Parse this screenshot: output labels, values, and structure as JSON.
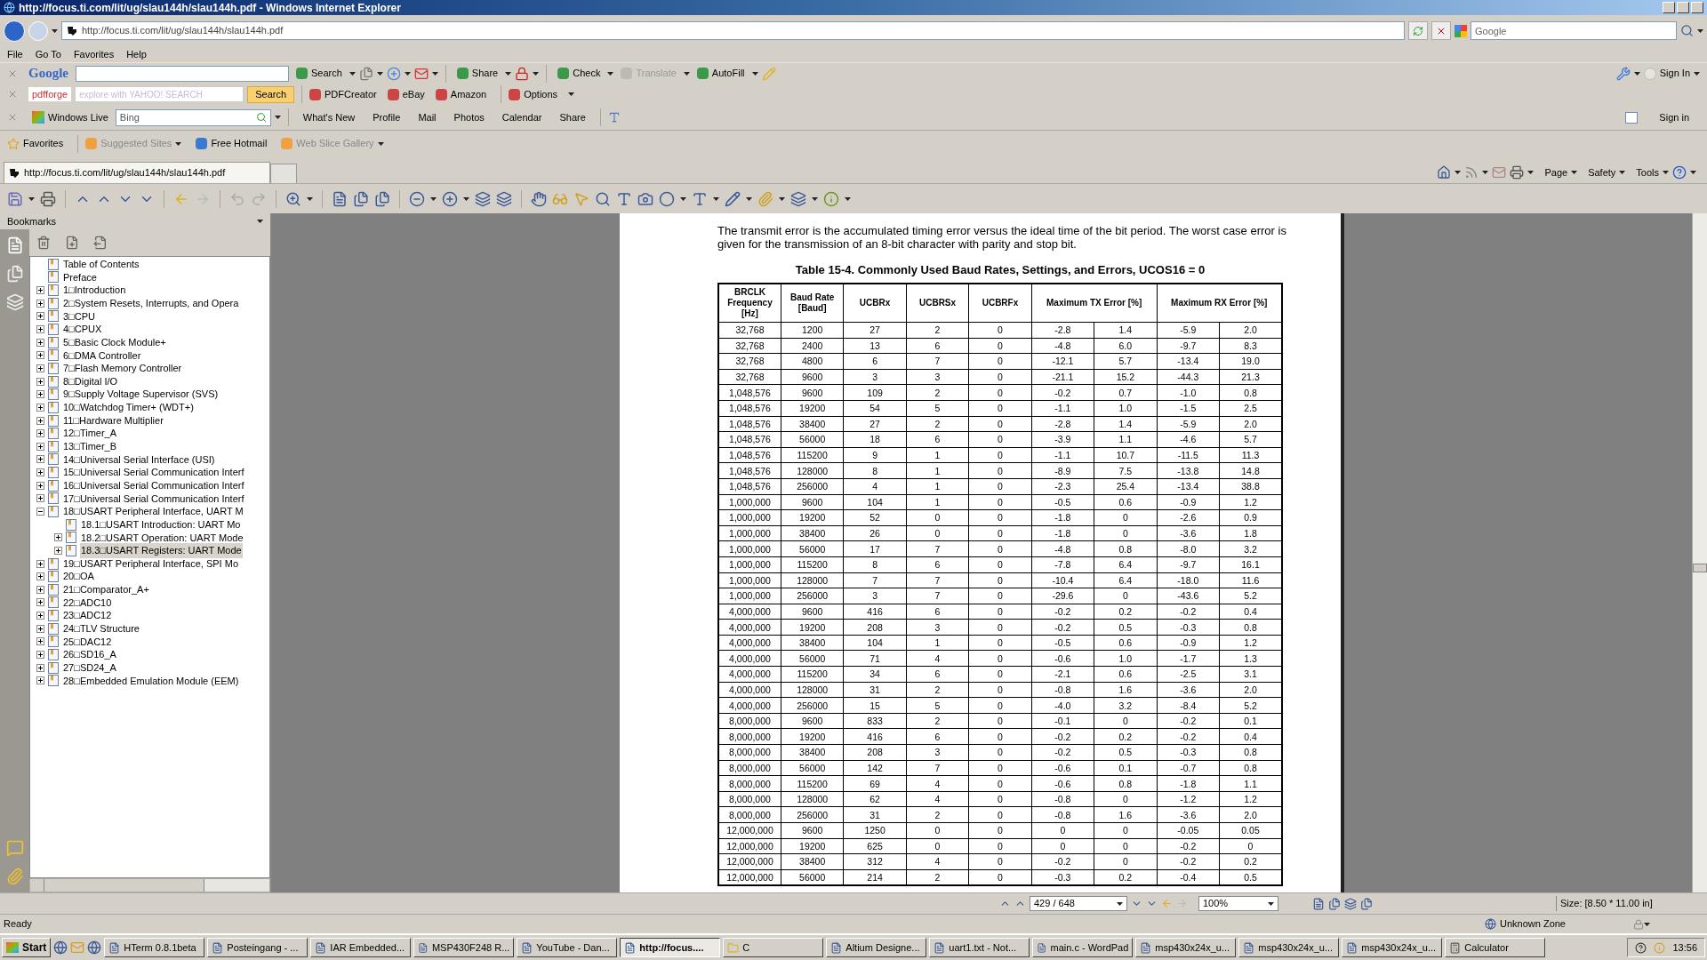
{
  "window": {
    "title": "http://focus.ti.com/lit/ug/slau144h/slau144h.pdf - Windows Internet Explorer"
  },
  "address_bar": {
    "url": "http://focus.ti.com/lit/ug/slau144h/slau144h.pdf",
    "search_placeholder": "Google"
  },
  "menu": [
    "File",
    "Go To",
    "Favorites",
    "Help"
  ],
  "google_toolbar": {
    "logo": "Google",
    "buttons": [
      {
        "label": "Search",
        "disabled": false
      },
      {
        "label": "Share",
        "disabled": false
      },
      {
        "label": "Check",
        "disabled": false
      },
      {
        "label": "Translate",
        "disabled": true
      },
      {
        "label": "AutoFill",
        "disabled": false
      }
    ],
    "sign_in": "Sign In"
  },
  "pdfforge_toolbar": {
    "logo": "pdfforge",
    "search_placeholder": "explore with YAHOO! SEARCH",
    "search_button": "Search",
    "links": [
      "PDFCreator",
      "eBay",
      "Amazon",
      "Options"
    ]
  },
  "live_toolbar": {
    "brand": "Windows Live",
    "search_value": "Bing",
    "links": [
      "What's New",
      "Profile",
      "Mail",
      "Photos",
      "Calendar",
      "Share"
    ],
    "sign_in": "Sign in"
  },
  "favorites_bar": {
    "label": "Favorites",
    "items": [
      {
        "label": "Suggested Sites",
        "disabled": true
      },
      {
        "label": "Free Hotmail",
        "disabled": false
      },
      {
        "label": "Web Slice Gallery",
        "disabled": true
      }
    ]
  },
  "tabs": [
    {
      "label": "http://focus.ti.com/lit/ug/slau144h/slau144h.pdf",
      "selected": true
    }
  ],
  "command_bar": [
    "Page",
    "Safety",
    "Tools"
  ],
  "bookmarks": {
    "title": "Bookmarks",
    "items": [
      {
        "label": "Table of Contents",
        "selected": false
      },
      {
        "label": "Preface",
        "selected": false
      },
      {
        "label": "1□Introduction",
        "expanded": false,
        "selected": false
      },
      {
        "label": "2□System Resets, Interrupts, and Opera",
        "expanded": false,
        "selected": false
      },
      {
        "label": "3□CPU",
        "expanded": false,
        "selected": false
      },
      {
        "label": "4□CPUX",
        "expanded": false,
        "selected": false
      },
      {
        "label": "5□Basic Clock Module+",
        "expanded": false,
        "selected": false
      },
      {
        "label": "6□DMA Controller",
        "expanded": false,
        "selected": false
      },
      {
        "label": "7□Flash Memory Controller",
        "expanded": false,
        "selected": false
      },
      {
        "label": "8□Digital I/O",
        "expanded": false,
        "selected": false
      },
      {
        "label": "9□Supply Voltage Supervisor (SVS)",
        "expanded": false,
        "selected": false
      },
      {
        "label": "10□Watchdog Timer+ (WDT+)",
        "expanded": false,
        "selected": false
      },
      {
        "label": "11□Hardware Multiplier",
        "expanded": false,
        "selected": false
      },
      {
        "label": "12□Timer_A",
        "expanded": false,
        "selected": false
      },
      {
        "label": "13□Timer_B",
        "expanded": false,
        "selected": false
      },
      {
        "label": "14□Universal Serial Interface (USI)",
        "expanded": false,
        "selected": false
      },
      {
        "label": "15□Universal Serial Communication Interf",
        "expanded": false,
        "selected": false
      },
      {
        "label": "16□Universal Serial Communication Interf",
        "expanded": false,
        "selected": false
      },
      {
        "label": "17□Universal Serial Communication Interf",
        "expanded": false,
        "selected": false
      },
      {
        "label": "18□USART Peripheral Interface, UART M",
        "expanded": true,
        "selected": false,
        "children": [
          {
            "label": "18.1□USART Introduction: UART Mo",
            "selected": false
          },
          {
            "label": "18.2□USART Operation: UART Mode",
            "expanded": false,
            "selected": false
          },
          {
            "label": "18.3□USART Registers: UART Mode",
            "expanded": false,
            "selected": true
          }
        ]
      },
      {
        "label": "19□USART Peripheral Interface, SPI Mo",
        "expanded": false,
        "selected": false
      },
      {
        "label": "20□OA",
        "expanded": false,
        "selected": false
      },
      {
        "label": "21□Comparator_A+",
        "expanded": false,
        "selected": false
      },
      {
        "label": "22□ADC10",
        "expanded": false,
        "selected": false
      },
      {
        "label": "23□ADC12",
        "expanded": false,
        "selected": false
      },
      {
        "label": "24□TLV Structure",
        "expanded": false,
        "selected": false
      },
      {
        "label": "25□DAC12",
        "expanded": false,
        "selected": false
      },
      {
        "label": "26□SD16_A",
        "expanded": false,
        "selected": false
      },
      {
        "label": "27□SD24_A",
        "expanded": false,
        "selected": false
      },
      {
        "label": "28□Embedded Emulation Module (EEM)",
        "expanded": false,
        "selected": false
      }
    ]
  },
  "document": {
    "paragraph": "The transmit error is the accumulated timing error versus the ideal time of the bit period. The worst case error is given for the transmission of an 8-bit character with parity and stop bit.",
    "table_title": "Table 15-4. Commonly Used Baud Rates, Settings, and Errors, UCOS16 = 0",
    "columns": [
      {
        "label": "BRCLK Frequency [Hz]",
        "kind": "single"
      },
      {
        "label": "Baud Rate [Baud]",
        "kind": "single"
      },
      {
        "label": "UCBRx",
        "kind": "single"
      },
      {
        "label": "UCBRSx",
        "kind": "single"
      },
      {
        "label": "UCBRFx",
        "kind": "single"
      },
      {
        "label": "Maximum TX Error [%]",
        "kind": "pair",
        "colspan": 2
      },
      {
        "label": "Maximum RX Error [%]",
        "kind": "pair",
        "colspan": 2
      }
    ],
    "rows": [
      [
        "32,768",
        "1200",
        "27",
        "2",
        "0",
        "-2.8",
        "1.4",
        "-5.9",
        "2.0"
      ],
      [
        "32,768",
        "2400",
        "13",
        "6",
        "0",
        "-4.8",
        "6.0",
        "-9.7",
        "8.3"
      ],
      [
        "32,768",
        "4800",
        "6",
        "7",
        "0",
        "-12.1",
        "5.7",
        "-13.4",
        "19.0"
      ],
      [
        "32,768",
        "9600",
        "3",
        "3",
        "0",
        "-21.1",
        "15.2",
        "-44.3",
        "21.3"
      ],
      [
        "1,048,576",
        "9600",
        "109",
        "2",
        "0",
        "-0.2",
        "0.7",
        "-1.0",
        "0.8"
      ],
      [
        "1,048,576",
        "19200",
        "54",
        "5",
        "0",
        "-1.1",
        "1.0",
        "-1.5",
        "2.5"
      ],
      [
        "1,048,576",
        "38400",
        "27",
        "2",
        "0",
        "-2.8",
        "1.4",
        "-5.9",
        "2.0"
      ],
      [
        "1,048,576",
        "56000",
        "18",
        "6",
        "0",
        "-3.9",
        "1.1",
        "-4.6",
        "5.7"
      ],
      [
        "1,048,576",
        "115200",
        "9",
        "1",
        "0",
        "-1.1",
        "10.7",
        "-11.5",
        "11.3"
      ],
      [
        "1,048,576",
        "128000",
        "8",
        "1",
        "0",
        "-8.9",
        "7.5",
        "-13.8",
        "14.8"
      ],
      [
        "1,048,576",
        "256000",
        "4",
        "1",
        "0",
        "-2.3",
        "25.4",
        "-13.4",
        "38.8"
      ],
      [
        "1,000,000",
        "9600",
        "104",
        "1",
        "0",
        "-0.5",
        "0.6",
        "-0.9",
        "1.2"
      ],
      [
        "1,000,000",
        "19200",
        "52",
        "0",
        "0",
        "-1.8",
        "0",
        "-2.6",
        "0.9"
      ],
      [
        "1,000,000",
        "38400",
        "26",
        "0",
        "0",
        "-1.8",
        "0",
        "-3.6",
        "1.8"
      ],
      [
        "1,000,000",
        "56000",
        "17",
        "7",
        "0",
        "-4.8",
        "0.8",
        "-8.0",
        "3.2"
      ],
      [
        "1,000,000",
        "115200",
        "8",
        "6",
        "0",
        "-7.8",
        "6.4",
        "-9.7",
        "16.1"
      ],
      [
        "1,000,000",
        "128000",
        "7",
        "7",
        "0",
        "-10.4",
        "6.4",
        "-18.0",
        "11.6"
      ],
      [
        "1,000,000",
        "256000",
        "3",
        "7",
        "0",
        "-29.6",
        "0",
        "-43.6",
        "5.2"
      ],
      [
        "4,000,000",
        "9600",
        "416",
        "6",
        "0",
        "-0.2",
        "0.2",
        "-0.2",
        "0.4"
      ],
      [
        "4,000,000",
        "19200",
        "208",
        "3",
        "0",
        "-0.2",
        "0.5",
        "-0.3",
        "0.8"
      ],
      [
        "4,000,000",
        "38400",
        "104",
        "1",
        "0",
        "-0.5",
        "0.6",
        "-0.9",
        "1.2"
      ],
      [
        "4,000,000",
        "56000",
        "71",
        "4",
        "0",
        "-0.6",
        "1.0",
        "-1.7",
        "1.3"
      ],
      [
        "4,000,000",
        "115200",
        "34",
        "6",
        "0",
        "-2.1",
        "0.6",
        "-2.5",
        "3.1"
      ],
      [
        "4,000,000",
        "128000",
        "31",
        "2",
        "0",
        "-0.8",
        "1.6",
        "-3.6",
        "2.0"
      ],
      [
        "4,000,000",
        "256000",
        "15",
        "5",
        "0",
        "-4.0",
        "3.2",
        "-8.4",
        "5.2"
      ],
      [
        "8,000,000",
        "9600",
        "833",
        "2",
        "0",
        "-0.1",
        "0",
        "-0.2",
        "0.1"
      ],
      [
        "8,000,000",
        "19200",
        "416",
        "6",
        "0",
        "-0.2",
        "0.2",
        "-0.2",
        "0.4"
      ],
      [
        "8,000,000",
        "38400",
        "208",
        "3",
        "0",
        "-0.2",
        "0.5",
        "-0.3",
        "0.8"
      ],
      [
        "8,000,000",
        "56000",
        "142",
        "7",
        "0",
        "-0.6",
        "0.1",
        "-0.7",
        "0.8"
      ],
      [
        "8,000,000",
        "115200",
        "69",
        "4",
        "0",
        "-0.6",
        "0.8",
        "-1.8",
        "1.1"
      ],
      [
        "8,000,000",
        "128000",
        "62",
        "4",
        "0",
        "-0.8",
        "0",
        "-1.2",
        "1.2"
      ],
      [
        "8,000,000",
        "256000",
        "31",
        "2",
        "0",
        "-0.8",
        "1.6",
        "-3.6",
        "2.0"
      ],
      [
        "12,000,000",
        "9600",
        "1250",
        "0",
        "0",
        "0",
        "0",
        "-0.05",
        "0.05"
      ],
      [
        "12,000,000",
        "19200",
        "625",
        "0",
        "0",
        "0",
        "0",
        "-0.2",
        "0"
      ],
      [
        "12,000,000",
        "38400",
        "312",
        "4",
        "0",
        "-0.2",
        "0",
        "-0.2",
        "0.2"
      ],
      [
        "12,000,000",
        "56000",
        "214",
        "2",
        "0",
        "-0.3",
        "0.2",
        "-0.4",
        "0.5"
      ]
    ]
  },
  "pdf_status": {
    "page": "429 / 648",
    "zoom": "100%",
    "size": "Size: [8.50 * 11.00 in]"
  },
  "status_bar": {
    "text": "Ready",
    "zone": "Unknown Zone"
  },
  "taskbar": {
    "start": "Start",
    "tasks": [
      {
        "label": "HTerm 0.8.1beta",
        "selected": false
      },
      {
        "label": "Posteingang - ...",
        "selected": false
      },
      {
        "label": "IAR Embedded...",
        "selected": false
      },
      {
        "label": "MSP430F248 R...",
        "selected": false
      },
      {
        "label": "YouTube - Dan...",
        "selected": false
      },
      {
        "label": "http://focus....",
        "selected": true
      },
      {
        "label": "C",
        "selected": false
      },
      {
        "label": "Altium Designe...",
        "selected": false
      },
      {
        "label": "uart1.txt - Not...",
        "selected": false
      },
      {
        "label": "main.c - WordPad",
        "selected": false
      },
      {
        "label": "msp430x24x_u...",
        "selected": false
      },
      {
        "label": "msp430x24x_u...",
        "selected": false
      },
      {
        "label": "msp430x24x_u...",
        "selected": false
      },
      {
        "label": "Calculator",
        "selected": false
      }
    ],
    "clock": "13:56"
  }
}
